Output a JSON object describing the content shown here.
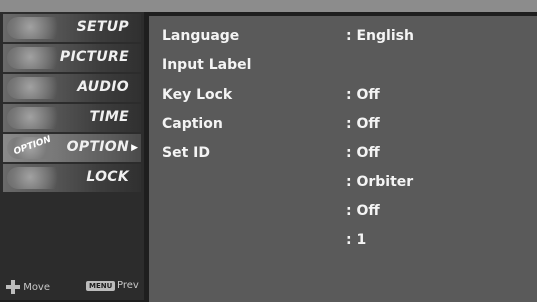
{
  "sidebar": {
    "items": [
      {
        "label": "SETUP",
        "icon": "satellite-dish-icon"
      },
      {
        "label": "PICTURE",
        "icon": "picture-icon"
      },
      {
        "label": "AUDIO",
        "icon": "speaker-icon"
      },
      {
        "label": "TIME",
        "icon": "clock-icon"
      },
      {
        "label": "OPTION",
        "icon": "option-icon",
        "thumb_text": "OPTION",
        "selected": true
      },
      {
        "label": "LOCK",
        "icon": "lock-icon"
      }
    ],
    "footer": {
      "move_label": "Move",
      "menu_button_label": "MENU",
      "prev_label": "Prev"
    }
  },
  "main": {
    "settings": [
      {
        "key": "Language",
        "value": ": English"
      },
      {
        "key": "Input Label",
        "value": ""
      },
      {
        "key": "Key Lock",
        "value": ": Off"
      },
      {
        "key": "Caption",
        "value": ": Off"
      },
      {
        "key": "Set ID",
        "value": ": Off"
      },
      {
        "key": "",
        "value": ": Orbiter"
      },
      {
        "key": "",
        "value": ": Off"
      },
      {
        "key": "",
        "value": ": 1"
      }
    ]
  },
  "colors": {
    "background": "#1e1e1e",
    "sidebar": "#2c2c2c",
    "content_panel": "#5a5a5a",
    "text": "#f4f4f4"
  }
}
